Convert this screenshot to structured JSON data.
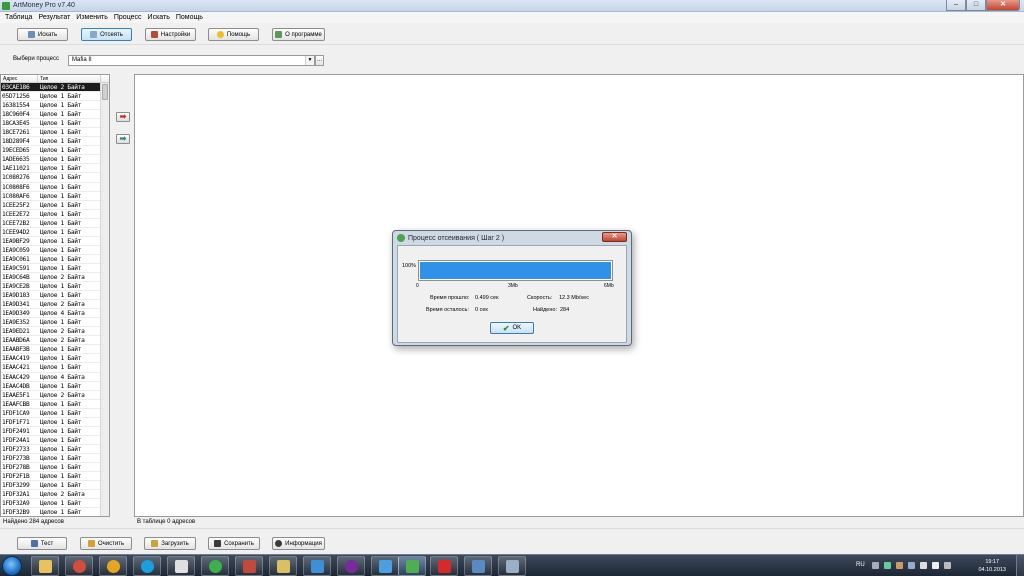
{
  "window": {
    "title": "ArtMoney Pro v7.40",
    "minimize": "–",
    "maximize": "□",
    "close": "✕"
  },
  "menu": [
    "Таблица",
    "Результат",
    "Изменить",
    "Процесс",
    "Искать",
    "Помощь"
  ],
  "toolbar": {
    "search": "Искать",
    "filter": "Отсеять",
    "settings": "Настройки",
    "help": "Помощь",
    "about": "О программе"
  },
  "process": {
    "label": "Выбери процесс",
    "value": "Mafia II",
    "dots": "..."
  },
  "table": {
    "headers": {
      "address": "Адрес",
      "type": "Тип"
    },
    "rows": [
      {
        "address": "03CAE186",
        "type": "Целое 2 Байта"
      },
      {
        "address": "05D71256",
        "type": "Целое 1 Байт"
      },
      {
        "address": "16381554",
        "type": "Целое 1 Байт"
      },
      {
        "address": "18C960F4",
        "type": "Целое 1 Байт"
      },
      {
        "address": "18CA3E45",
        "type": "Целое 1 Байт"
      },
      {
        "address": "18CE7261",
        "type": "Целое 1 Байт"
      },
      {
        "address": "18D289F4",
        "type": "Целое 1 Байт"
      },
      {
        "address": "19ECED65",
        "type": "Целое 1 Байт"
      },
      {
        "address": "1ADE6635",
        "type": "Целое 1 Байт"
      },
      {
        "address": "1AE11021",
        "type": "Целое 1 Байт"
      },
      {
        "address": "1C080276",
        "type": "Целое 1 Байт"
      },
      {
        "address": "1C0808F6",
        "type": "Целое 1 Байт"
      },
      {
        "address": "1C080AF6",
        "type": "Целое 1 Байт"
      },
      {
        "address": "1CEE25F2",
        "type": "Целое 1 Байт"
      },
      {
        "address": "1CEE2E72",
        "type": "Целое 1 Байт"
      },
      {
        "address": "1CEE72B2",
        "type": "Целое 1 Байт"
      },
      {
        "address": "1CEE94D2",
        "type": "Целое 1 Байт"
      },
      {
        "address": "1EA9BF29",
        "type": "Целое 1 Байт"
      },
      {
        "address": "1EA9C059",
        "type": "Целое 1 Байт"
      },
      {
        "address": "1EA9C061",
        "type": "Целое 1 Байт"
      },
      {
        "address": "1EA9C591",
        "type": "Целое 1 Байт"
      },
      {
        "address": "1EA9C64B",
        "type": "Целое 2 Байта"
      },
      {
        "address": "1EA9CE2B",
        "type": "Целое 1 Байт"
      },
      {
        "address": "1EA9D183",
        "type": "Целое 1 Байт"
      },
      {
        "address": "1EA9D341",
        "type": "Целое 2 Байта"
      },
      {
        "address": "1EA9D349",
        "type": "Целое 4 Байта"
      },
      {
        "address": "1EA9E352",
        "type": "Целое 1 Байт"
      },
      {
        "address": "1EA9ED21",
        "type": "Целое 2 Байта"
      },
      {
        "address": "1EAABD6A",
        "type": "Целое 2 Байта"
      },
      {
        "address": "1EAABF3B",
        "type": "Целое 1 Байт"
      },
      {
        "address": "1EAAC419",
        "type": "Целое 1 Байт"
      },
      {
        "address": "1EAAC421",
        "type": "Целое 1 Байт"
      },
      {
        "address": "1EAAC429",
        "type": "Целое 4 Байта"
      },
      {
        "address": "1EAAC4DB",
        "type": "Целое 1 Байт"
      },
      {
        "address": "1EAAE5F1",
        "type": "Целое 2 Байта"
      },
      {
        "address": "1EAAFCBB",
        "type": "Целое 1 Байт"
      },
      {
        "address": "1FDF1CA9",
        "type": "Целое 1 Байт"
      },
      {
        "address": "1FDF1F71",
        "type": "Целое 1 Байт"
      },
      {
        "address": "1FDF2491",
        "type": "Целое 1 Байт"
      },
      {
        "address": "1FDF24A1",
        "type": "Целое 1 Байт"
      },
      {
        "address": "1FDF2733",
        "type": "Целое 1 Байт"
      },
      {
        "address": "1FDF273B",
        "type": "Целое 1 Байт"
      },
      {
        "address": "1FDF278B",
        "type": "Целое 1 Байт"
      },
      {
        "address": "1FDF2F1B",
        "type": "Целое 1 Байт"
      },
      {
        "address": "1FDF3299",
        "type": "Целое 1 Байт"
      },
      {
        "address": "1FDF32A1",
        "type": "Целое 2 Байта"
      },
      {
        "address": "1FDF32A9",
        "type": "Целое 1 Байт"
      },
      {
        "address": "1FDF32B9",
        "type": "Целое 1 Байт"
      }
    ]
  },
  "transfer": {
    "right": "➡",
    "left": "➡"
  },
  "status": {
    "left": "Найдено 284 адресов",
    "right": "В таблице 0 адресов"
  },
  "bottom": {
    "test": "Тест",
    "clear": "Очистить",
    "load": "Загрузить",
    "save": "Сохранить",
    "info": "Информация"
  },
  "dialog": {
    "title": "Процесс отсеивания ( Шаг 2 )",
    "close": "✕",
    "percent_label": "100%",
    "progress": 1.0,
    "ticks": [
      "0",
      "3Mb",
      "6Mb"
    ],
    "elapsed_label": "Время прошло:",
    "elapsed_value": "0.499 сек",
    "speed_label": "Скорость:",
    "speed_value": "12.3 Mb/sec",
    "remaining_label": "Время осталось:",
    "remaining_value": "0 сек",
    "found_label": "Найдено:",
    "found_value": "284",
    "ok": "OK"
  },
  "taskbar": {
    "lang": "RU",
    "time": "19:17",
    "date": "04.10.2013"
  },
  "colors": {
    "progress": "#2f92e8",
    "selection": "#1c1c1c"
  }
}
